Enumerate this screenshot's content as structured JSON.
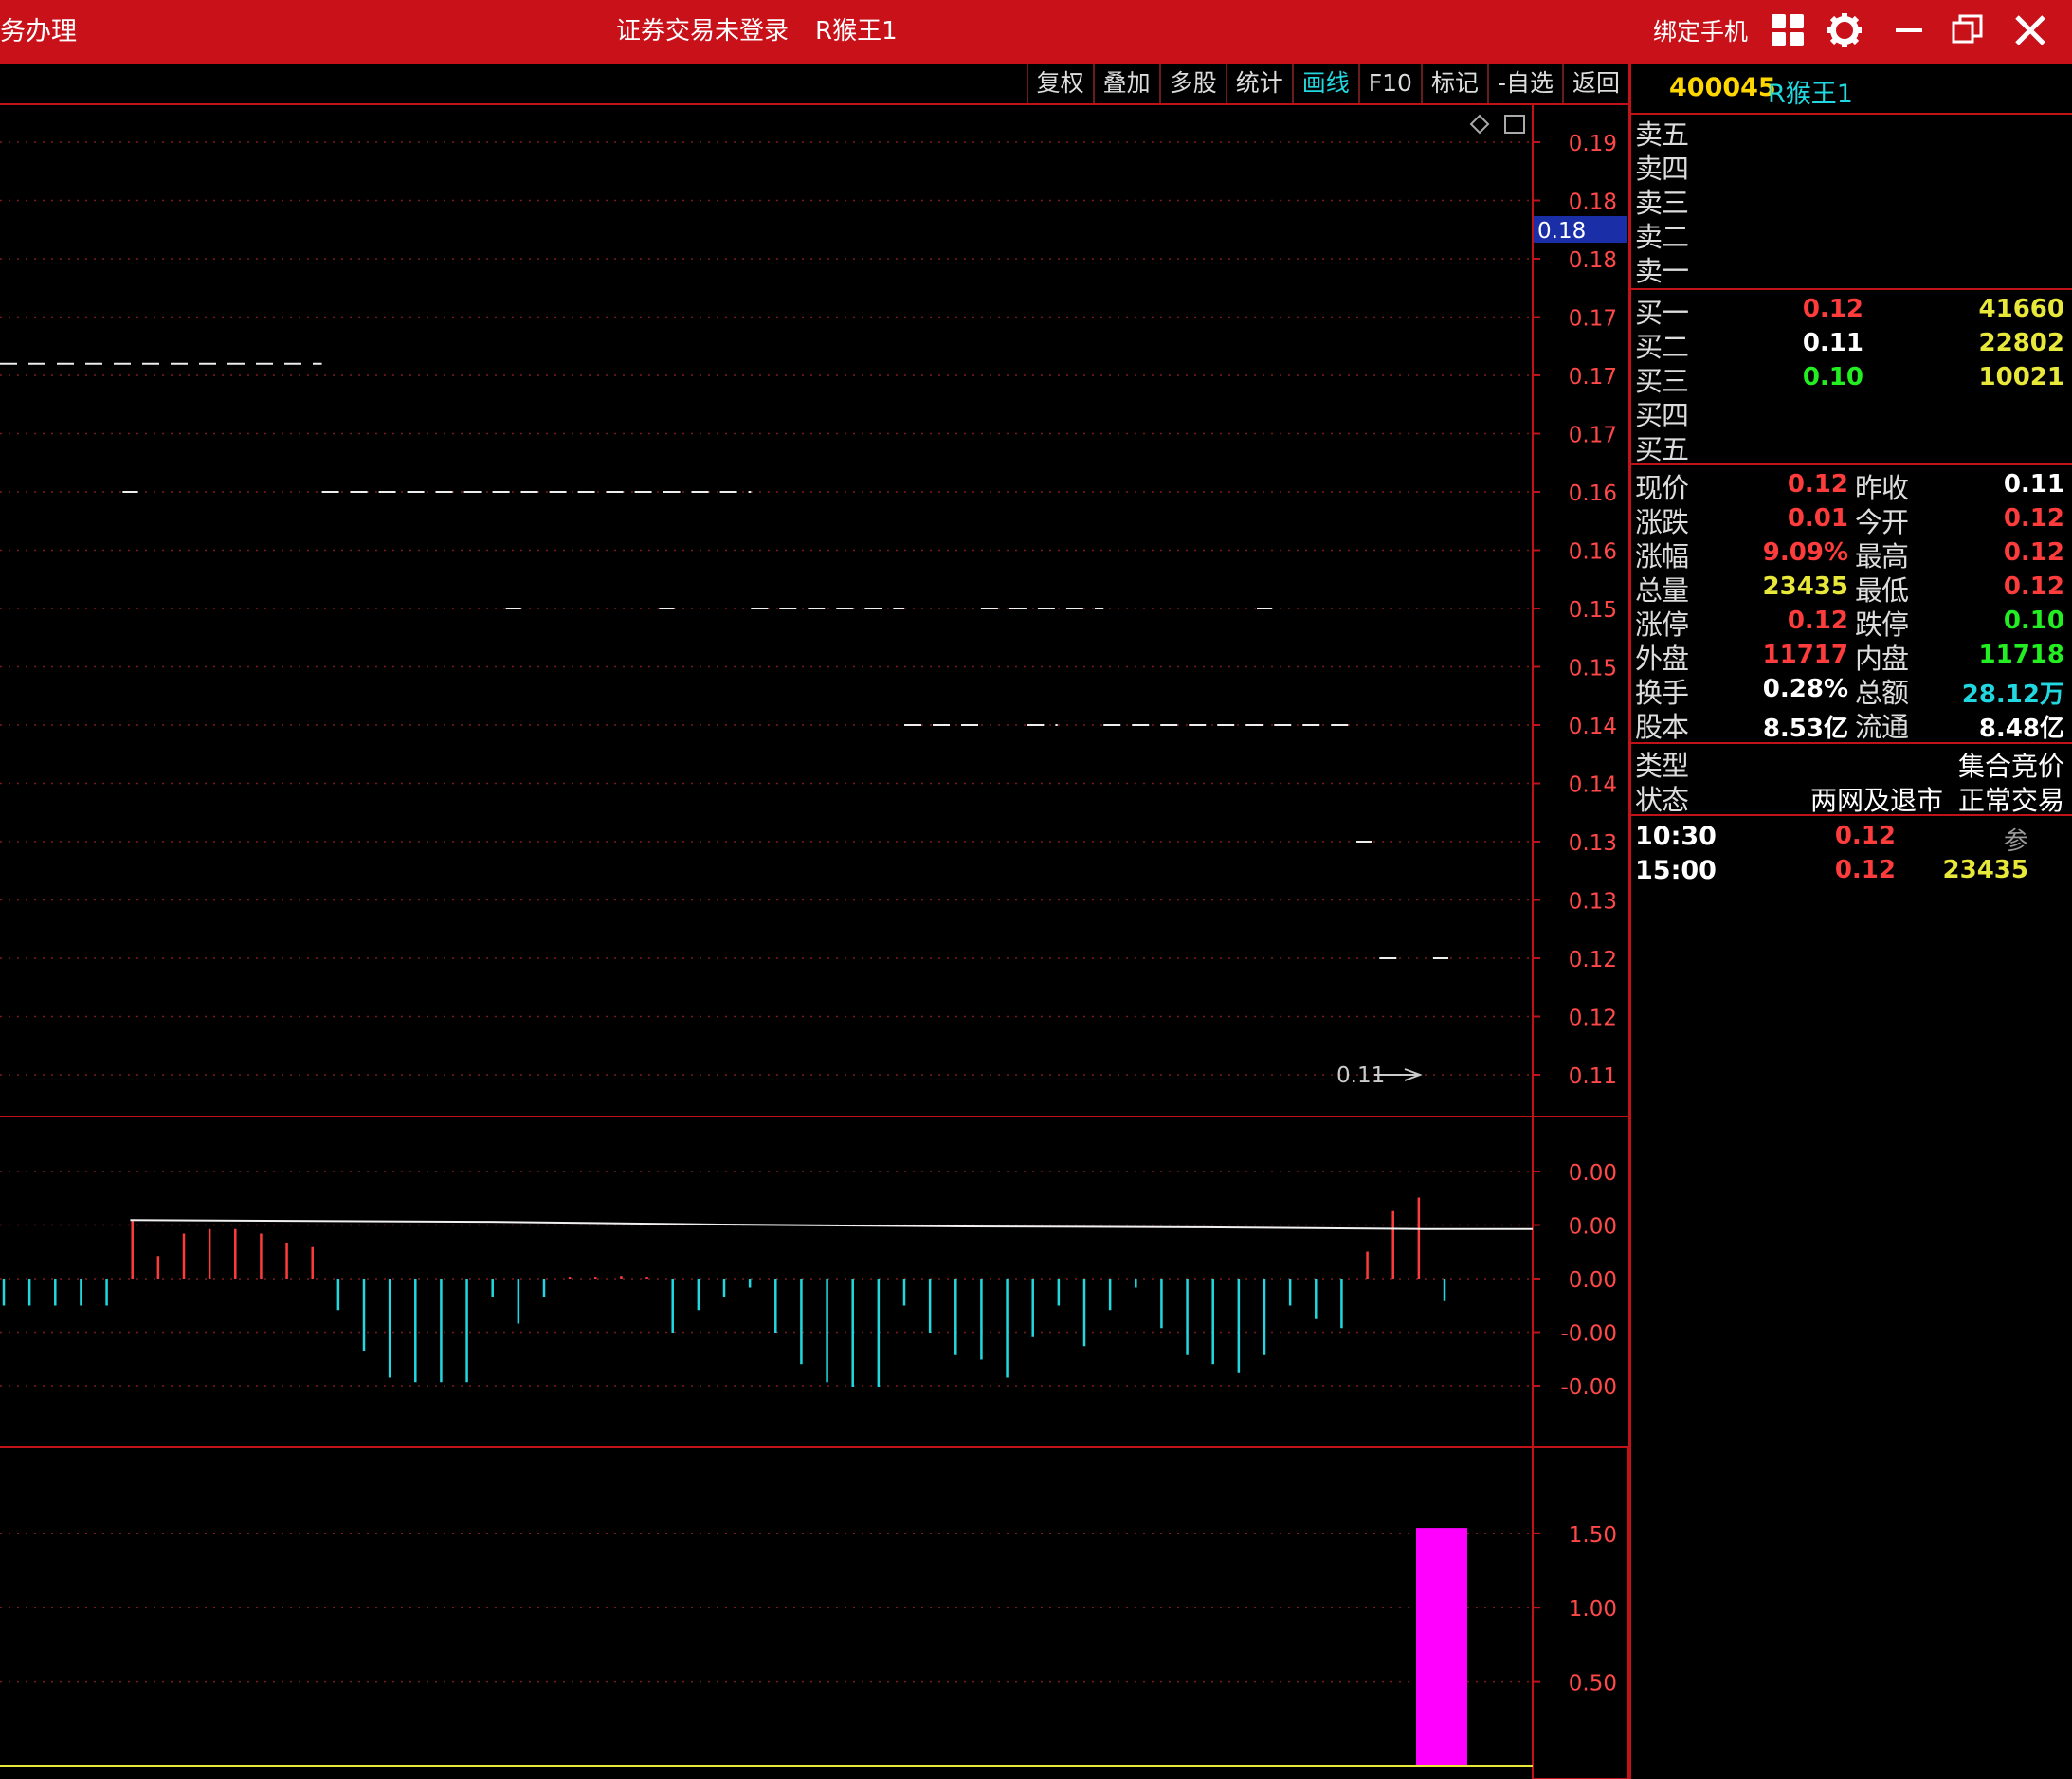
{
  "titlebar": {
    "left_text": "务办理",
    "center_status": "证券交易未登录",
    "center_name": "R猴王1",
    "bind_phone": "绑定手机"
  },
  "toolbar": {
    "tabs": [
      {
        "label": "复权",
        "active": false
      },
      {
        "label": "叠加",
        "active": false
      },
      {
        "label": "多股",
        "active": false
      },
      {
        "label": "统计",
        "active": false
      },
      {
        "label": "画线",
        "active": true
      },
      {
        "label": "F10",
        "active": false
      },
      {
        "label": "标记",
        "active": false
      },
      {
        "label": "-自选",
        "active": false
      },
      {
        "label": "返回",
        "active": false
      }
    ]
  },
  "stock": {
    "code": "400045",
    "name": "R猴王1"
  },
  "orderbook": {
    "sell": [
      {
        "label": "卖五"
      },
      {
        "label": "卖四"
      },
      {
        "label": "卖三"
      },
      {
        "label": "卖二"
      },
      {
        "label": "卖一"
      }
    ],
    "buy": [
      {
        "label": "买一",
        "price": "0.12",
        "volume": "41660",
        "color": "red"
      },
      {
        "label": "买二",
        "price": "0.11",
        "volume": "22802",
        "color": "white"
      },
      {
        "label": "买三",
        "price": "0.10",
        "volume": "10021",
        "color": "green"
      },
      {
        "label": "买四",
        "price": "",
        "volume": "",
        "color": "white"
      },
      {
        "label": "买五",
        "price": "",
        "volume": "",
        "color": "white"
      }
    ]
  },
  "quote": {
    "rows": [
      {
        "l1": "现价",
        "v1": "0.12",
        "c1": "red",
        "l2": "昨收",
        "v2": "0.11",
        "c2": "white"
      },
      {
        "l1": "涨跌",
        "v1": "0.01",
        "c1": "red",
        "l2": "今开",
        "v2": "0.12",
        "c2": "red"
      },
      {
        "l1": "涨幅",
        "v1": "9.09%",
        "c1": "red",
        "l2": "最高",
        "v2": "0.12",
        "c2": "red"
      },
      {
        "l1": "总量",
        "v1": "23435",
        "c1": "yellow",
        "l2": "最低",
        "v2": "0.12",
        "c2": "red"
      },
      {
        "l1": "涨停",
        "v1": "0.12",
        "c1": "red",
        "l2": "跌停",
        "v2": "0.10",
        "c2": "green"
      },
      {
        "l1": "外盘",
        "v1": "11717",
        "c1": "red",
        "l2": "内盘",
        "v2": "11718",
        "c2": "green"
      },
      {
        "l1": "换手",
        "v1": "0.28%",
        "c1": "white",
        "l2": "总额",
        "v2": "28.12万",
        "c2": "cyan"
      },
      {
        "l1": "股本",
        "v1": "8.53亿",
        "c1": "white",
        "l2": "流通",
        "v2": "8.48亿",
        "c2": "white"
      }
    ]
  },
  "info": {
    "type_label": "类型",
    "type_value": "集合竞价",
    "status_label": "状态",
    "status_value1": "两网及退市",
    "status_value2": "正常交易"
  },
  "ticks": [
    {
      "time": "10:30",
      "price": "0.12",
      "extra": "参",
      "extra_color": "gray"
    },
    {
      "time": "15:00",
      "price": "0.12",
      "extra": "23435",
      "extra_color": "yellow"
    }
  ],
  "colors": {
    "accent_red": "#c9111a",
    "up": "#ff3c3c",
    "down": "#22d8e0",
    "volume_bar": "#ff00ff",
    "grid": "#8a1c1c"
  },
  "chart_data": {
    "type": "line",
    "price_panel": {
      "ytick_labels": [
        "0.19",
        "0.18",
        "0.18",
        "0.17",
        "0.17",
        "0.17",
        "0.16",
        "0.16",
        "0.15",
        "0.15",
        "0.14",
        "0.14",
        "0.13",
        "0.13",
        "0.12",
        "0.12",
        "0.11"
      ],
      "current_price_label": "0.18",
      "annotation": "0.11",
      "segments": [
        {
          "y": 0.171,
          "x0": 0,
          "x1": 0.21
        },
        {
          "y": 0.16,
          "x0": 0.08,
          "x1": 0.09
        },
        {
          "y": 0.16,
          "x0": 0.21,
          "x1": 0.49
        },
        {
          "y": 0.15,
          "x0": 0.33,
          "x1": 0.34
        },
        {
          "y": 0.15,
          "x0": 0.43,
          "x1": 0.44
        },
        {
          "y": 0.15,
          "x0": 0.49,
          "x1": 0.59
        },
        {
          "y": 0.15,
          "x0": 0.64,
          "x1": 0.72
        },
        {
          "y": 0.15,
          "x0": 0.82,
          "x1": 0.83
        },
        {
          "y": 0.14,
          "x0": 0.59,
          "x1": 0.64
        },
        {
          "y": 0.14,
          "x0": 0.67,
          "x1": 0.69
        },
        {
          "y": 0.14,
          "x0": 0.72,
          "x1": 0.88
        },
        {
          "y": 0.13,
          "x0": 0.885,
          "x1": 0.895
        },
        {
          "y": 0.12,
          "x0": 0.9,
          "x1": 0.915
        },
        {
          "y": 0.12,
          "x0": 0.935,
          "x1": 0.945
        }
      ],
      "ylim": [
        0.11,
        0.19
      ]
    },
    "macd_panel": {
      "ytick_labels": [
        "0.00",
        "0.00",
        "0.00",
        "-0.00",
        "-0.00"
      ],
      "bars": [
        -0.3,
        -0.3,
        -0.3,
        -0.3,
        -0.3,
        0.65,
        0.25,
        0.5,
        0.55,
        0.55,
        0.5,
        0.4,
        0.35,
        -0.35,
        -0.8,
        -1.1,
        -1.15,
        -1.15,
        -1.15,
        -0.2,
        -0.5,
        -0.2,
        0.02,
        0.02,
        0.03,
        0.02,
        -0.6,
        -0.35,
        -0.2,
        -0.1,
        -0.6,
        -0.95,
        -1.15,
        -1.2,
        -1.2,
        -0.3,
        -0.6,
        -0.85,
        -0.9,
        -1.1,
        -0.65,
        -0.3,
        -0.75,
        -0.35,
        -0.1,
        -0.55,
        -0.85,
        -0.95,
        -1.05,
        -0.85,
        -0.3,
        -0.45,
        -0.55,
        0.3,
        0.75,
        0.9,
        -0.25
      ],
      "signal_line": [
        {
          "x": 0.085,
          "y": 0.65
        },
        {
          "x": 0.32,
          "y": 0.63
        },
        {
          "x": 0.47,
          "y": 0.6
        },
        {
          "x": 0.62,
          "y": 0.58
        },
        {
          "x": 0.78,
          "y": 0.57
        },
        {
          "x": 0.93,
          "y": 0.55
        },
        {
          "x": 1.0,
          "y": 0.55
        }
      ],
      "ylim": [
        -1.25,
        1.0
      ]
    },
    "volume_panel": {
      "ytick_labels": [
        "1.50",
        "1.00",
        "0.50"
      ],
      "bars": [
        {
          "x": 0.94,
          "value": 1.6
        }
      ],
      "ylim": [
        0,
        1.75
      ]
    }
  }
}
